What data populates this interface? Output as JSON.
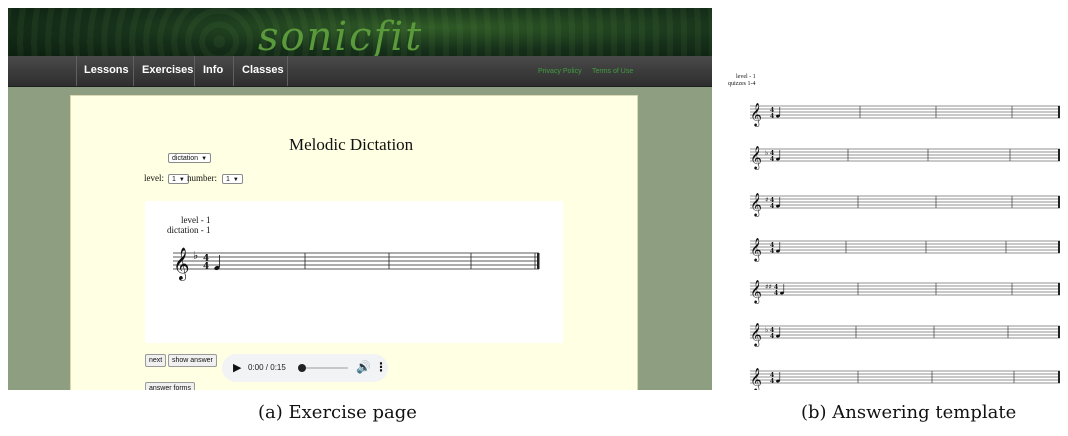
{
  "site": {
    "logo_text": "sonicfit",
    "nav": [
      "Lessons",
      "Exercises",
      "Info",
      "Classes"
    ],
    "links": [
      "Privacy Policy",
      "Terms of Use"
    ]
  },
  "exercise": {
    "title": "Melodic Dictation",
    "mode_select": "dictation",
    "level_label": "level:",
    "level_value": "1",
    "number_label": "number:",
    "number_value": "1",
    "score_label_1": "level - 1",
    "score_label_2": "dictation - 1",
    "buttons": {
      "next": "next",
      "show_answer": "show answer",
      "answer_forms": "answer forms"
    },
    "audio": {
      "time": "0:00 / 0:15",
      "progress": 0.0,
      "volume": 0.7
    }
  },
  "template": {
    "label_1": "level - 1",
    "label_2": "quizzes 1-4"
  },
  "captions": {
    "a": "(a)  Exercise page",
    "b": "(b)  Answering template"
  }
}
